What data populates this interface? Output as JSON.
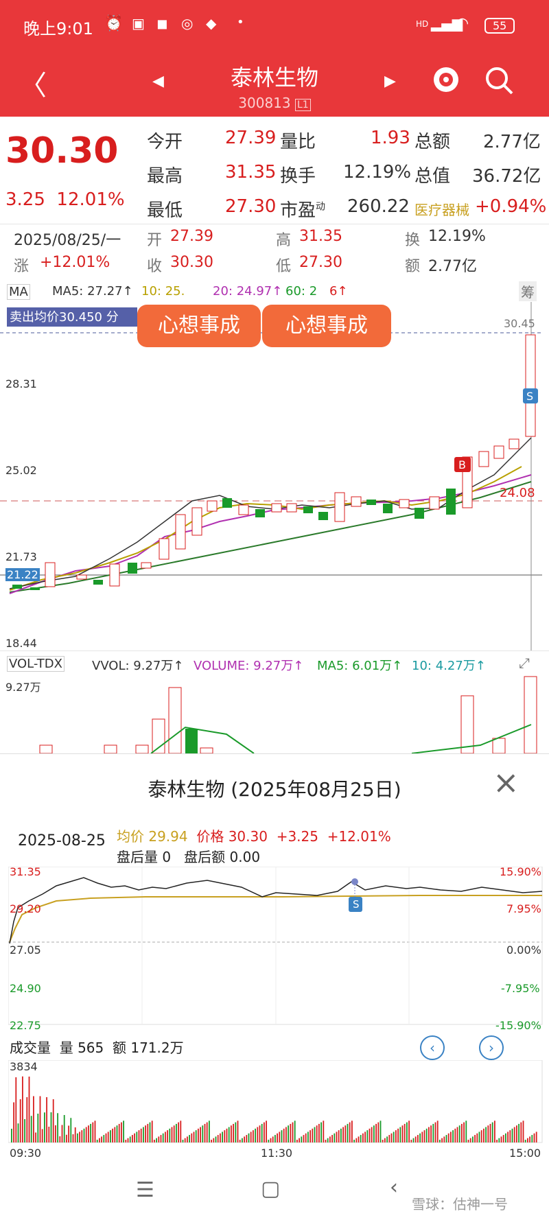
{
  "status": {
    "time": "晚上9:01",
    "network": "HD",
    "battery": "55"
  },
  "header": {
    "title": "泰林生物",
    "code": "300813",
    "badge": "L1"
  },
  "quote": {
    "price": "30.30",
    "change": "3.25",
    "change_pct": "12.01%",
    "rows": [
      {
        "l1": "今开",
        "v1": "27.39",
        "l2": "量比",
        "v2": "1.93",
        "l3": "总额",
        "v3": "2.77亿"
      },
      {
        "l1": "最高",
        "v1": "31.35",
        "l2": "换手",
        "v2": "12.19%",
        "l3": "总值",
        "v3": "36.72亿"
      },
      {
        "l1": "最低",
        "v1": "27.30",
        "l2": "市盈",
        "v2": "260.22",
        "l3": "医疗器械",
        "v3": "+0.94%"
      }
    ],
    "pe_sup": "动"
  },
  "bar": {
    "date": "2025/08/25/一",
    "open_l": "开",
    "open": "27.39",
    "high_l": "高",
    "high": "31.35",
    "turn_l": "换",
    "turn": "12.19%",
    "chg_l": "涨",
    "chg": "+12.01%",
    "close_l": "收",
    "close": "30.30",
    "low_l": "低",
    "low": "27.30",
    "amt_l": "额",
    "amt": "2.77亿"
  },
  "kline": {
    "ma_sel": "MA",
    "ma5": "MA5: 27.27↑",
    "ma10": "10: 25.",
    "ma20": "20: 24.97↑",
    "ma60": "60: 2",
    "ma60b": "6↑",
    "fuquan": "筹",
    "avg_tag": "卖出均价30.450 分",
    "sticker": "心想事成",
    "y_labels": [
      "30.45",
      "28.31",
      "25.02",
      "24.08",
      "21.73",
      "21.22",
      "18.44"
    ],
    "buy": "B",
    "sell": "S"
  },
  "vol": {
    "sel": "VOL-TDX",
    "vvol": "VVOL: 9.27万↑",
    "volume": "VOLUME: 9.27万↑",
    "ma5": "MA5: 6.01万↑",
    "ma10": "10: 4.27万↑",
    "y": "9.27万"
  },
  "intraday": {
    "title": "泰林生物 (2025年08月25日)",
    "date": "2025-08-25",
    "avg_l": "均价",
    "avg": "29.94",
    "price_l": "价格",
    "price": "30.30",
    "chg": "+3.25",
    "pct": "+12.01%",
    "after_vol_l": "盘后量",
    "after_vol": "0",
    "after_amt_l": "盘后额",
    "after_amt": "0.00",
    "left_axis": [
      "31.35",
      "29.20",
      "27.05",
      "24.90",
      "22.75"
    ],
    "right_axis": [
      "15.90%",
      "7.95%",
      "0.00%",
      "-7.95%",
      "-15.90%"
    ],
    "sell": "S",
    "vol_label": "成交量",
    "vol_l": "量",
    "vol": "565",
    "amt_l": "额",
    "amt": "171.2万",
    "vol_y": "3834",
    "times": [
      "09:30",
      "11:30",
      "15:00"
    ]
  },
  "footer": {
    "watermark": "雪球：估神一号"
  },
  "colors": {
    "up": "#d81e1e",
    "down": "#1a9a2a",
    "header": "#e8373a",
    "avg": "#c8a020"
  }
}
